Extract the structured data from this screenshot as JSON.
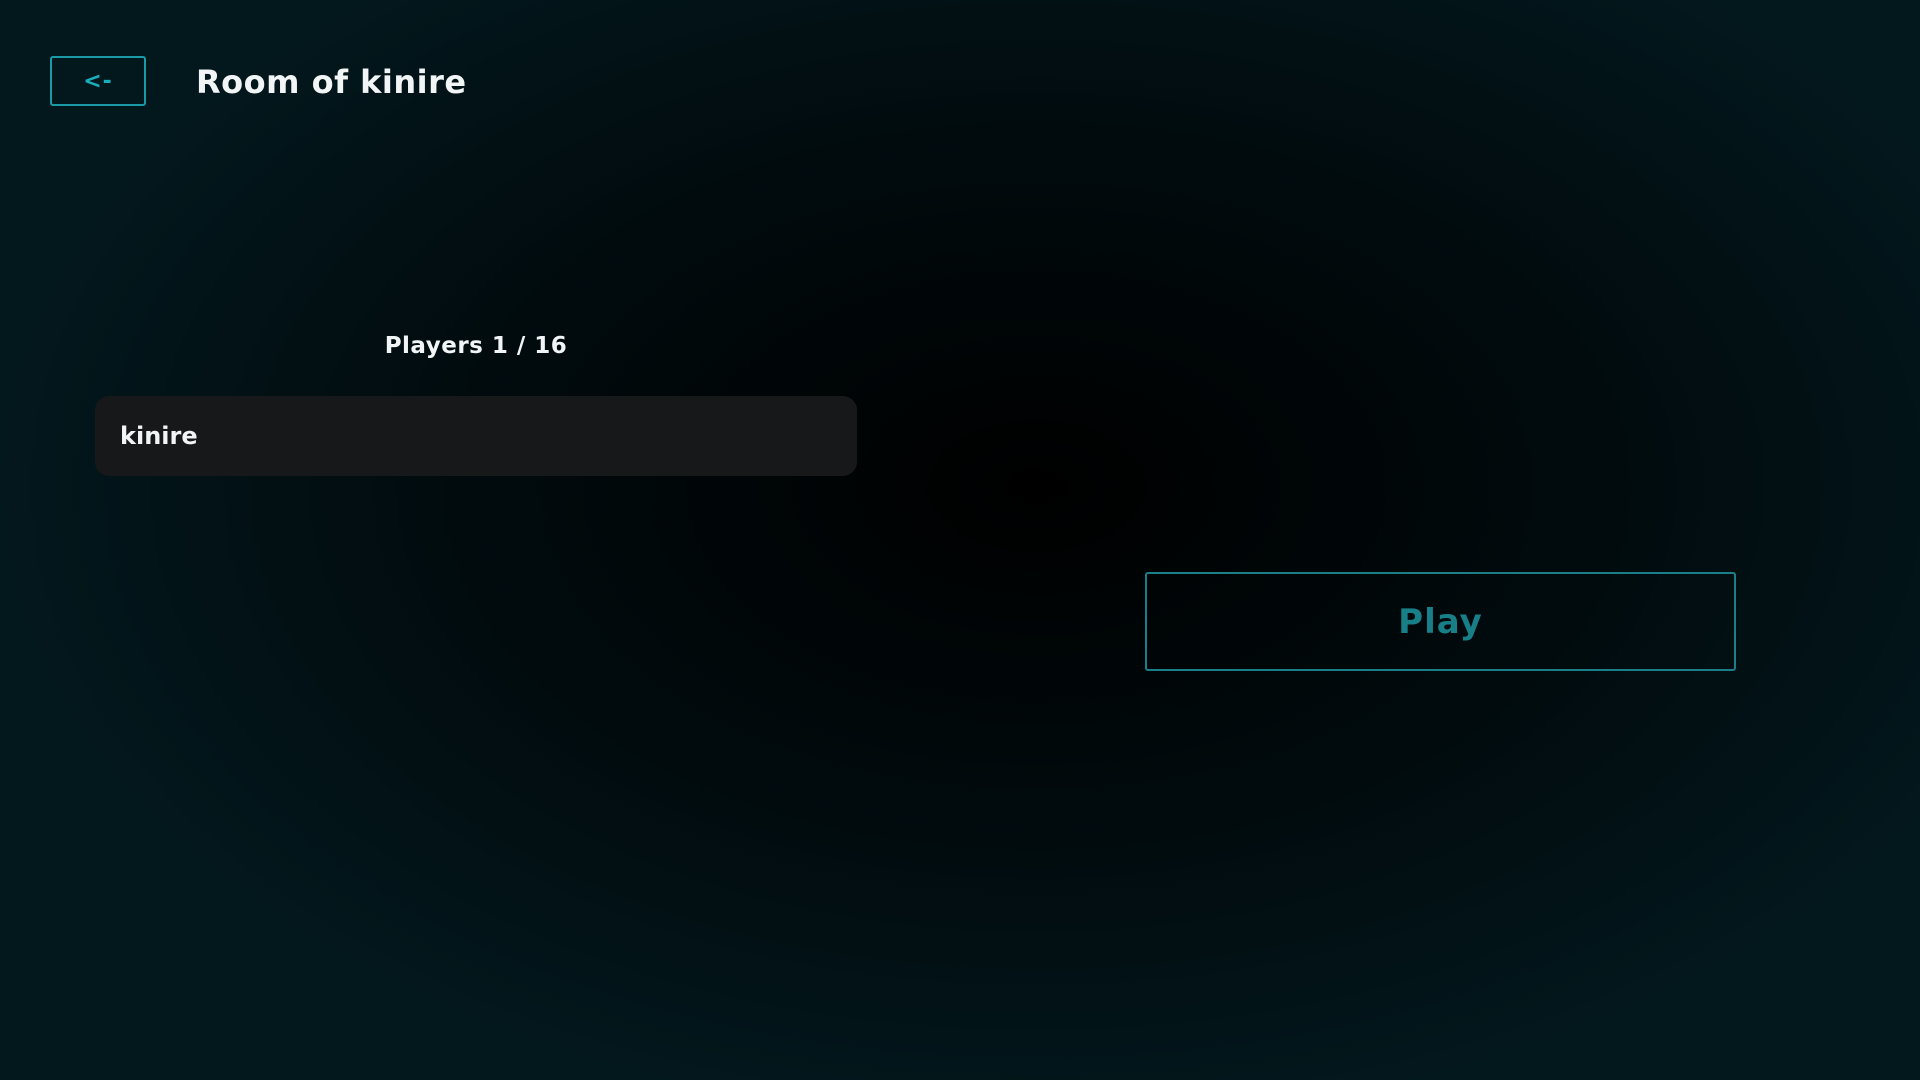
{
  "header": {
    "back_label": "<-",
    "title": "Room of kinire"
  },
  "players": {
    "heading": "Players 1 / 16",
    "list": [
      {
        "name": "kinire"
      }
    ]
  },
  "actions": {
    "play_label": "Play"
  },
  "colors": {
    "accent": "#1a9aa6",
    "play_accent": "#187f89",
    "background_center": "#000000",
    "background_edge": "#03181d",
    "player_row": "#161819"
  }
}
